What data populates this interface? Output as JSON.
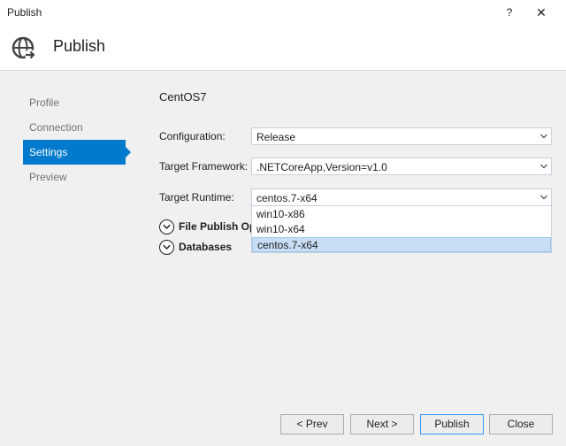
{
  "window": {
    "title": "Publish",
    "help_label": "?",
    "close_label": "✕"
  },
  "header": {
    "title": "Publish",
    "icon": "globe-publish-icon"
  },
  "nav": {
    "items": [
      {
        "label": "Profile"
      },
      {
        "label": "Connection"
      },
      {
        "label": "Settings"
      },
      {
        "label": "Preview"
      }
    ],
    "active_index": 2
  },
  "main": {
    "profile_name": "CentOS7",
    "configuration": {
      "label": "Configuration:",
      "value": "Release"
    },
    "framework": {
      "label": "Target Framework:",
      "value": ".NETCoreApp,Version=v1.0"
    },
    "runtime": {
      "label": "Target Runtime:",
      "value": "centos.7-x64",
      "options": [
        "win10-x86",
        "win10-x64",
        "centos.7-x64"
      ],
      "highlighted_index": 2
    },
    "expanders": [
      {
        "label": "File Publish Options"
      },
      {
        "label": "Databases"
      }
    ]
  },
  "footer": {
    "prev_label": "< Prev",
    "next_label": "Next >",
    "publish_label": "Publish",
    "close_label": "Close"
  },
  "colors": {
    "accent": "#007acc",
    "selected_bg": "#c9def5",
    "background": "#f0f0f0"
  }
}
